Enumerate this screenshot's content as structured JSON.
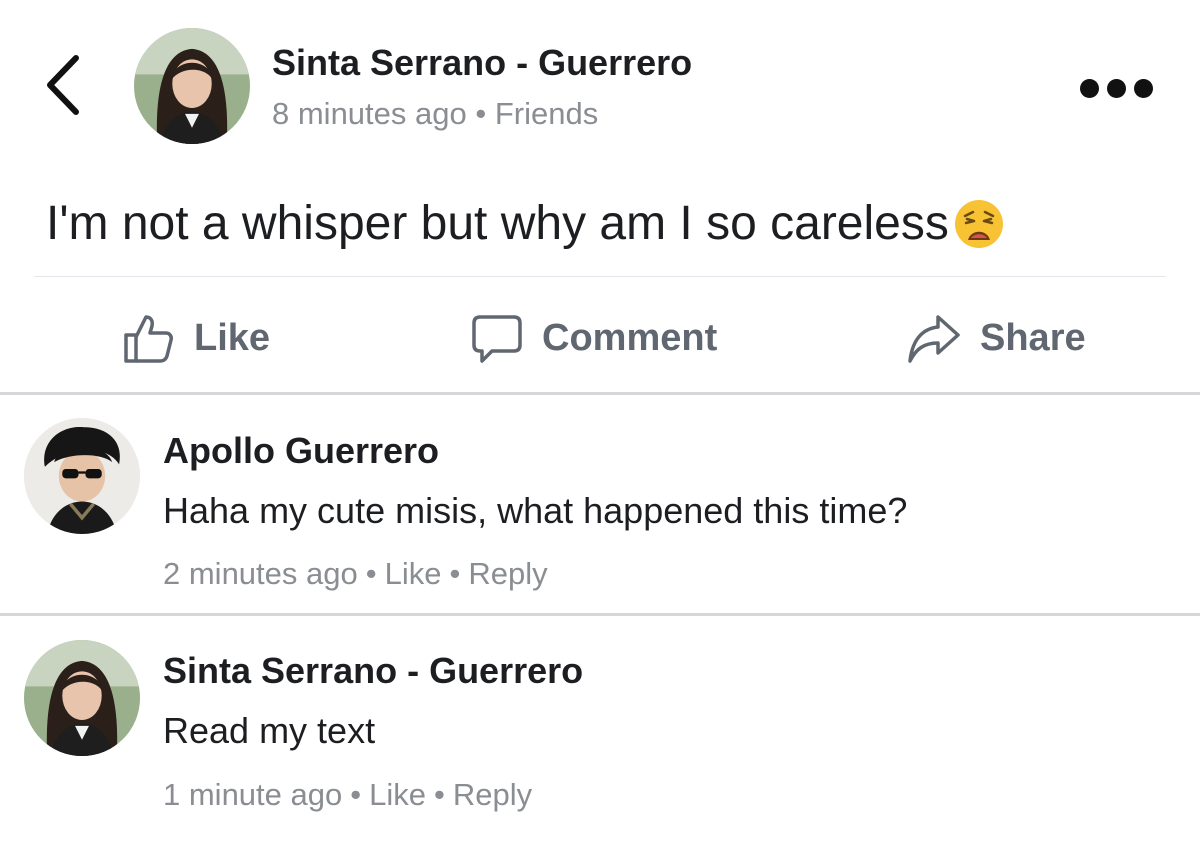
{
  "post": {
    "author": "Sinta Serrano - Guerrero",
    "time": "8 minutes ago",
    "separator": "•",
    "audience": "Friends",
    "text": "I'm not a whisper but why am I so careless",
    "emoji": "weary-face-emoji"
  },
  "actions": {
    "like_label": "Like",
    "comment_label": "Comment",
    "share_label": "Share"
  },
  "comments": [
    {
      "author": "Apollo Guerrero",
      "text": "Haha my cute misis, what happened this time?",
      "time": "2 minutes ago",
      "like_label": "Like",
      "reply_label": "Reply"
    },
    {
      "author": "Sinta Serrano - Guerrero",
      "text": "Read my text",
      "time": "1 minute ago",
      "like_label": "Like",
      "reply_label": "Reply"
    }
  ],
  "meta_separator": "•",
  "icons": {
    "back": "chevron-left-icon",
    "more": "more-horizontal-icon",
    "like": "thumbs-up-icon",
    "comment": "comment-bubble-icon",
    "share": "share-arrow-icon"
  },
  "colors": {
    "text_primary": "#1c1e21",
    "text_secondary": "#8a8d91",
    "action_gray": "#606770",
    "divider": "#d5d7db"
  }
}
